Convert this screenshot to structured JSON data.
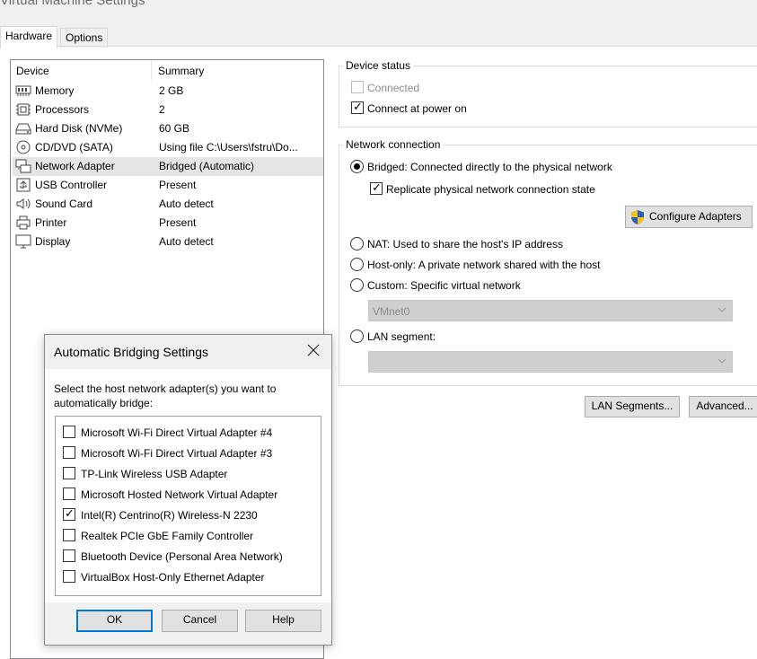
{
  "window": {
    "title": "Virtual Machine Settings"
  },
  "tabs": [
    {
      "label": "Hardware"
    },
    {
      "label": "Options"
    }
  ],
  "device_list": {
    "columns": {
      "device": "Device",
      "summary": "Summary"
    },
    "rows": [
      {
        "icon": "memory-icon",
        "name": "Memory",
        "summary": "2 GB"
      },
      {
        "icon": "processor-icon",
        "name": "Processors",
        "summary": "2"
      },
      {
        "icon": "hard-disk-icon",
        "name": "Hard Disk (NVMe)",
        "summary": "60 GB"
      },
      {
        "icon": "cd-dvd-icon",
        "name": "CD/DVD (SATA)",
        "summary": "Using file C:\\Users\\fstru\\Do..."
      },
      {
        "icon": "network-adapter-icon",
        "name": "Network Adapter",
        "summary": "Bridged (Automatic)",
        "selected": true
      },
      {
        "icon": "usb-icon",
        "name": "USB Controller",
        "summary": "Present"
      },
      {
        "icon": "sound-card-icon",
        "name": "Sound Card",
        "summary": "Auto detect"
      },
      {
        "icon": "printer-icon",
        "name": "Printer",
        "summary": "Present"
      },
      {
        "icon": "display-icon",
        "name": "Display",
        "summary": "Auto detect"
      }
    ]
  },
  "device_status": {
    "title": "Device status",
    "connected": {
      "label": "Connected",
      "checked": false,
      "disabled": true
    },
    "connect_at_power_on": {
      "label": "Connect at power on",
      "checked": true
    }
  },
  "network_connection": {
    "title": "Network connection",
    "bridged": {
      "label": "Bridged: Connected directly to the physical network",
      "selected": true
    },
    "replicate": {
      "label": "Replicate physical network connection state",
      "checked": true
    },
    "configure_adapters": "Configure Adapters",
    "nat": {
      "label": "NAT: Used to share the host's IP address",
      "selected": false
    },
    "host_only": {
      "label": "Host-only: A private network shared with the host",
      "selected": false
    },
    "custom": {
      "label": "Custom: Specific virtual network",
      "selected": false
    },
    "custom_network_select": "VMnet0",
    "lan_segment": {
      "label": "LAN segment:",
      "selected": false
    },
    "lan_segment_select": ""
  },
  "buttons": {
    "lan_segments": "LAN Segments...",
    "advanced": "Advanced..."
  },
  "dialog": {
    "title": "Automatic Bridging Settings",
    "description": "Select the host network adapter(s) you want to automatically bridge:",
    "adapters": [
      {
        "label": "Microsoft Wi-Fi Direct Virtual Adapter #4",
        "checked": false
      },
      {
        "label": "Microsoft Wi-Fi Direct Virtual Adapter #3",
        "checked": false
      },
      {
        "label": "TP-Link Wireless USB Adapter",
        "checked": false
      },
      {
        "label": "Microsoft Hosted Network Virtual Adapter",
        "checked": false
      },
      {
        "label": "Intel(R) Centrino(R) Wireless-N 2230",
        "checked": true
      },
      {
        "label": "Realtek PCIe GbE Family Controller",
        "checked": false
      },
      {
        "label": "Bluetooth Device (Personal Area Network)",
        "checked": false
      },
      {
        "label": "VirtualBox Host-Only Ethernet Adapter",
        "checked": false
      }
    ],
    "ok": "OK",
    "cancel": "Cancel",
    "help": "Help"
  },
  "colors": {
    "accent": "#0078d7",
    "selection": "#e5e5e5",
    "shield_blue": "#2b5fb4",
    "shield_yellow": "#f2c21b"
  }
}
